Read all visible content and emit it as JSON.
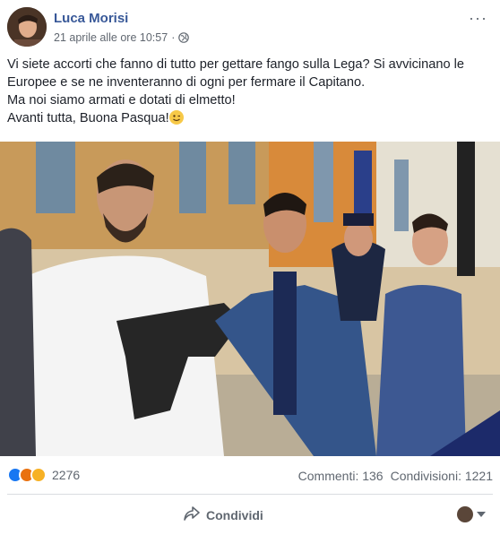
{
  "post": {
    "author": "Luca Morisi",
    "timestamp": "21 aprile alle ore 10:57",
    "separator": "·",
    "privacy_icon": "globe-icon",
    "more_label": "···",
    "text_lines": [
      "Vi siete accorti che fanno di tutto per gettare fango sulla Lega? Si avvicinano le Europee e se ne inventeranno di ogni per fermare il Capitano.",
      "Ma noi siamo armati e dotati di elmetto!",
      "Avanti tutta, Buona Pasqua!"
    ],
    "emoji": "winking-face"
  },
  "stats": {
    "reaction_icons": [
      "like",
      "angry",
      "haha"
    ],
    "reaction_count": "2276",
    "comments": "Commenti: 136",
    "shares": "Condivisioni: 1221"
  },
  "actions": {
    "share_label": "Condividi"
  },
  "colors": {
    "author": "#385898",
    "like": "#1877f2",
    "angry": "#e9710f",
    "haha": "#f7b125"
  }
}
